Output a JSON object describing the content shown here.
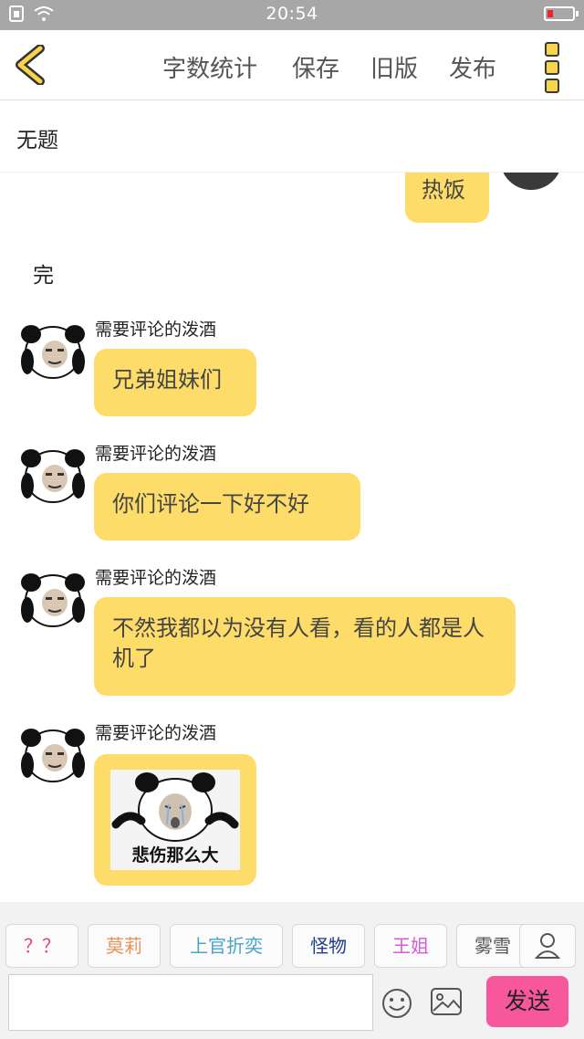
{
  "status_bar": {
    "time": "20:54"
  },
  "toolbar": {
    "word_count": "字数统计",
    "save": "保存",
    "old_version": "旧版",
    "publish": "发布"
  },
  "title": "无题",
  "chat": {
    "partial_message": "热饭",
    "plain_text": "完",
    "messages": [
      {
        "name": "需要评论的泼酒",
        "text": "兄弟姐妹们"
      },
      {
        "name": "需要评论的泼酒",
        "text": "你们评论一下好不好"
      },
      {
        "name": "需要评论的泼酒",
        "text": "不然我都以为没有人看，看的人都是人机了"
      },
      {
        "name": "需要评论的泼酒",
        "sticker_caption": "悲伤那么大"
      }
    ]
  },
  "quick_recipients": [
    {
      "label": "？？",
      "color": "#e0457b"
    },
    {
      "label": "莫莉",
      "color": "#e8935a"
    },
    {
      "label": "上官折奕",
      "color": "#4aa3c8"
    },
    {
      "label": "怪物",
      "color": "#1f3d8a"
    },
    {
      "label": "王姐",
      "color": "#d75ad6"
    },
    {
      "label": "雾雪",
      "color": "#555555"
    }
  ],
  "input": {
    "placeholder": ""
  },
  "send_label": "发送",
  "colors": {
    "bubble": "#fddc6a",
    "send": "#f7589b",
    "status_bar": "#a7a7a7"
  }
}
